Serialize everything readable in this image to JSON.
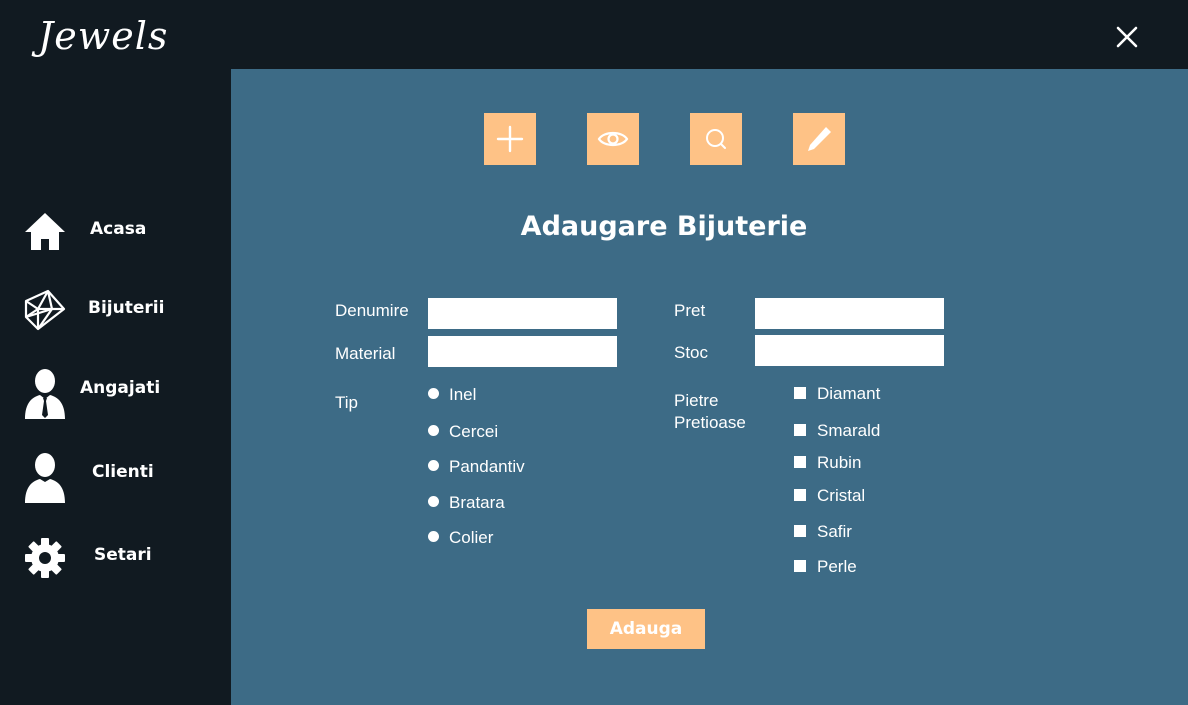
{
  "app": {
    "title": "Jewels"
  },
  "sidebar": {
    "items": [
      {
        "label": "Acasa",
        "icon": "home-icon"
      },
      {
        "label": "Bijuterii",
        "icon": "diamond-icon"
      },
      {
        "label": "Angajati",
        "icon": "employee-icon"
      },
      {
        "label": "Clienti",
        "icon": "user-icon"
      },
      {
        "label": "Setari",
        "icon": "gear-icon"
      }
    ]
  },
  "toolbar": {
    "buttons": [
      {
        "icon": "plus-icon"
      },
      {
        "icon": "eye-icon"
      },
      {
        "icon": "search-icon"
      },
      {
        "icon": "pencil-icon"
      }
    ]
  },
  "form": {
    "title": "Adaugare Bijuterie",
    "fields": {
      "denumire": {
        "label": "Denumire",
        "value": ""
      },
      "material": {
        "label": "Material",
        "value": ""
      },
      "pret": {
        "label": "Pret",
        "value": ""
      },
      "stoc": {
        "label": "Stoc",
        "value": ""
      }
    },
    "tip": {
      "label": "Tip",
      "options": [
        "Inel",
        "Cercei",
        "Pandantiv",
        "Bratara",
        "Colier"
      ]
    },
    "pietre": {
      "label_line1": "Pietre",
      "label_line2": "Pretioase",
      "options": [
        "Diamant",
        "Smarald",
        "Rubin",
        "Cristal",
        "Safir",
        "Perle"
      ]
    },
    "submit_label": "Adauga"
  },
  "colors": {
    "sidebar_bg": "#111a21",
    "main_bg": "#3d6b86",
    "accent": "#fec286"
  }
}
